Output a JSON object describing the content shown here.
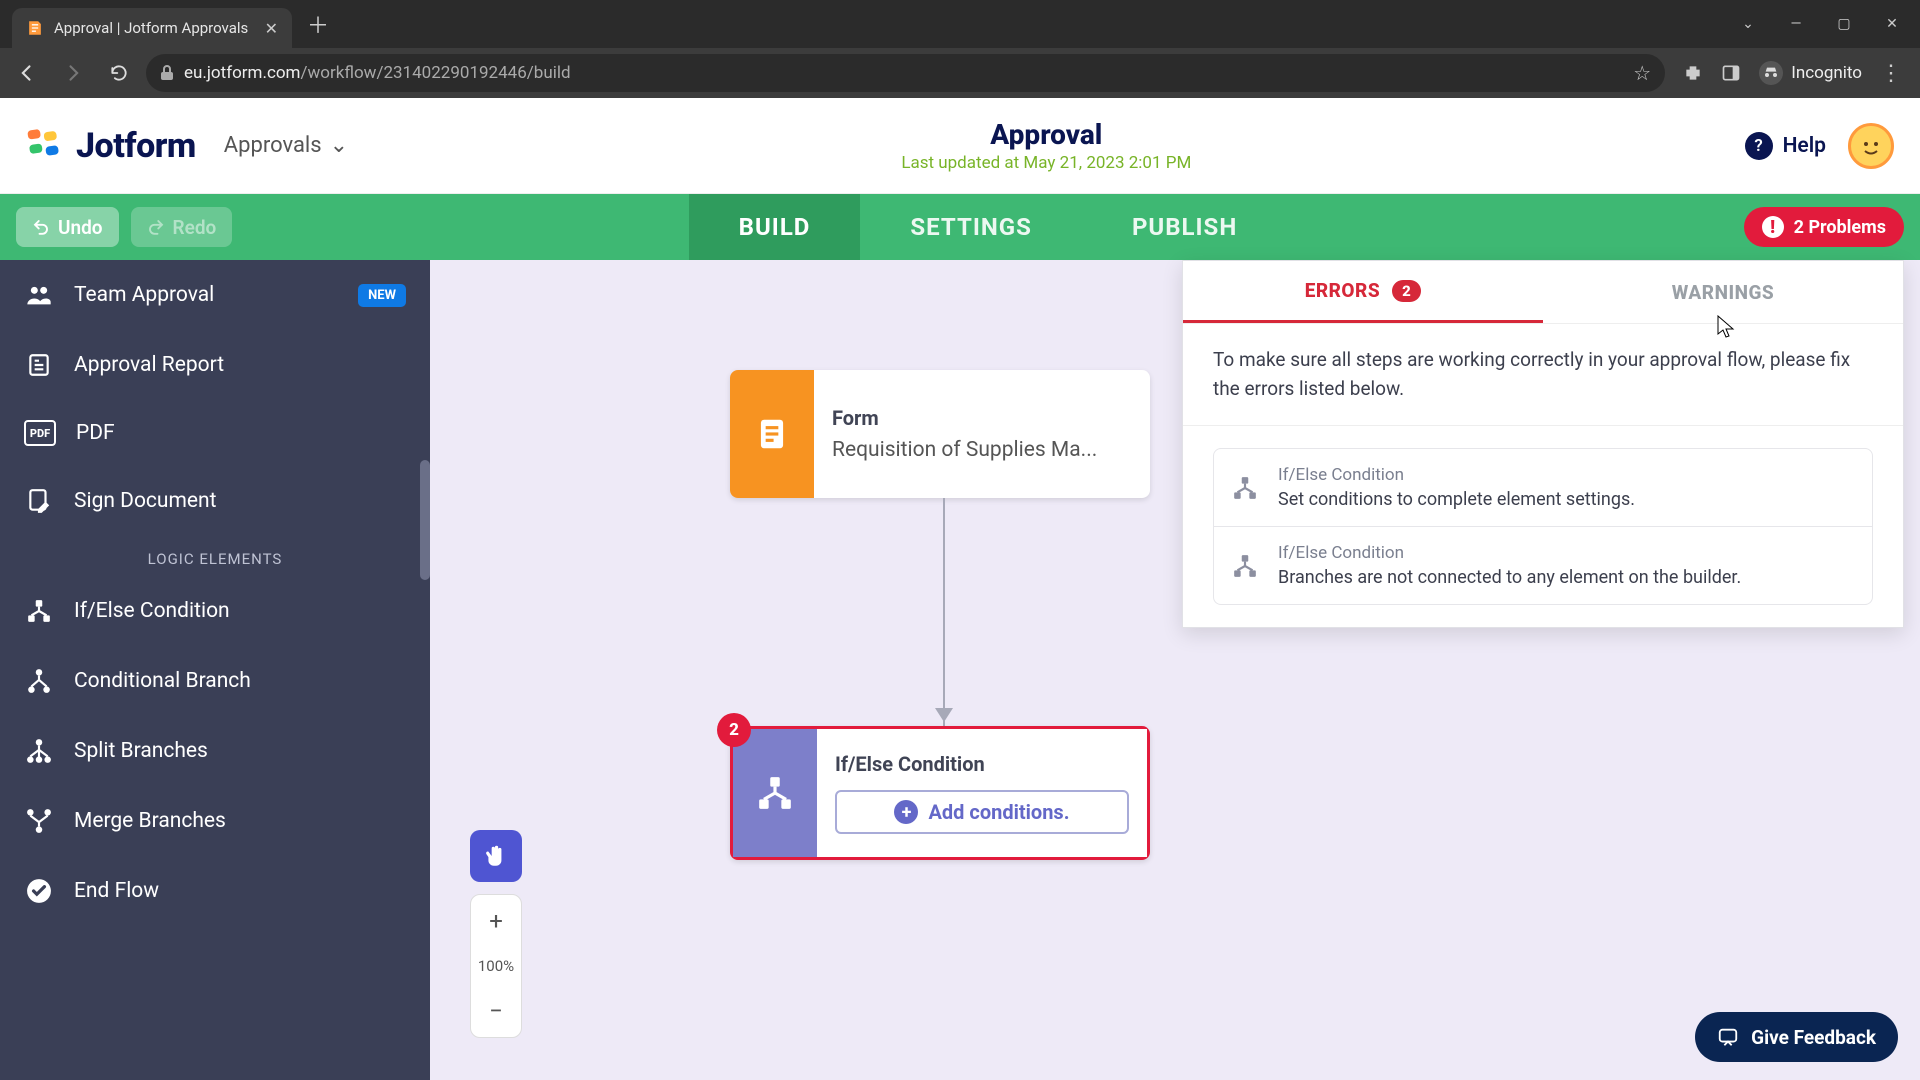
{
  "browser": {
    "tab_title": "Approval | Jotform Approvals",
    "url_host": "eu.jotform.com",
    "url_path": "/workflow/231402290192446/build",
    "incognito_label": "Incognito"
  },
  "header": {
    "logo": "Jotform",
    "product": "Approvals",
    "title": "Approval",
    "updated": "Last updated at May 21, 2023 2:01 PM",
    "help": "Help"
  },
  "tabbar": {
    "undo": "Undo",
    "redo": "Redo",
    "tabs": {
      "build": "BUILD",
      "settings": "SETTINGS",
      "publish": "PUBLISH"
    },
    "problems": "2 Problems"
  },
  "sidebar": {
    "items": [
      {
        "label": "Team Approval",
        "badge": "NEW"
      },
      {
        "label": "Approval Report"
      },
      {
        "label": "PDF",
        "icon_text": "PDF"
      },
      {
        "label": "Sign Document"
      }
    ],
    "section": "LOGIC ELEMENTS",
    "logic": [
      {
        "label": "If/Else Condition"
      },
      {
        "label": "Conditional Branch"
      },
      {
        "label": "Split Branches"
      },
      {
        "label": "Merge Branches"
      },
      {
        "label": "End Flow"
      }
    ]
  },
  "canvas": {
    "form_node": {
      "title": "Form",
      "subtitle": "Requisition of Supplies Ma..."
    },
    "cond_node": {
      "title": "If/Else Condition",
      "button": "Add conditions.",
      "badge": "2"
    },
    "zoom": "100%"
  },
  "problems": {
    "tabs": {
      "errors": "ERRORS",
      "errors_count": "2",
      "warnings": "WARNINGS"
    },
    "description": "To make sure all steps are working correctly in your approval flow, please fix the errors listed below.",
    "items": [
      {
        "title": "If/Else Condition",
        "msg": "Set conditions to complete element settings."
      },
      {
        "title": "If/Else Condition",
        "msg": "Branches are not connected to any element on the builder."
      }
    ]
  },
  "feedback": "Give Feedback"
}
